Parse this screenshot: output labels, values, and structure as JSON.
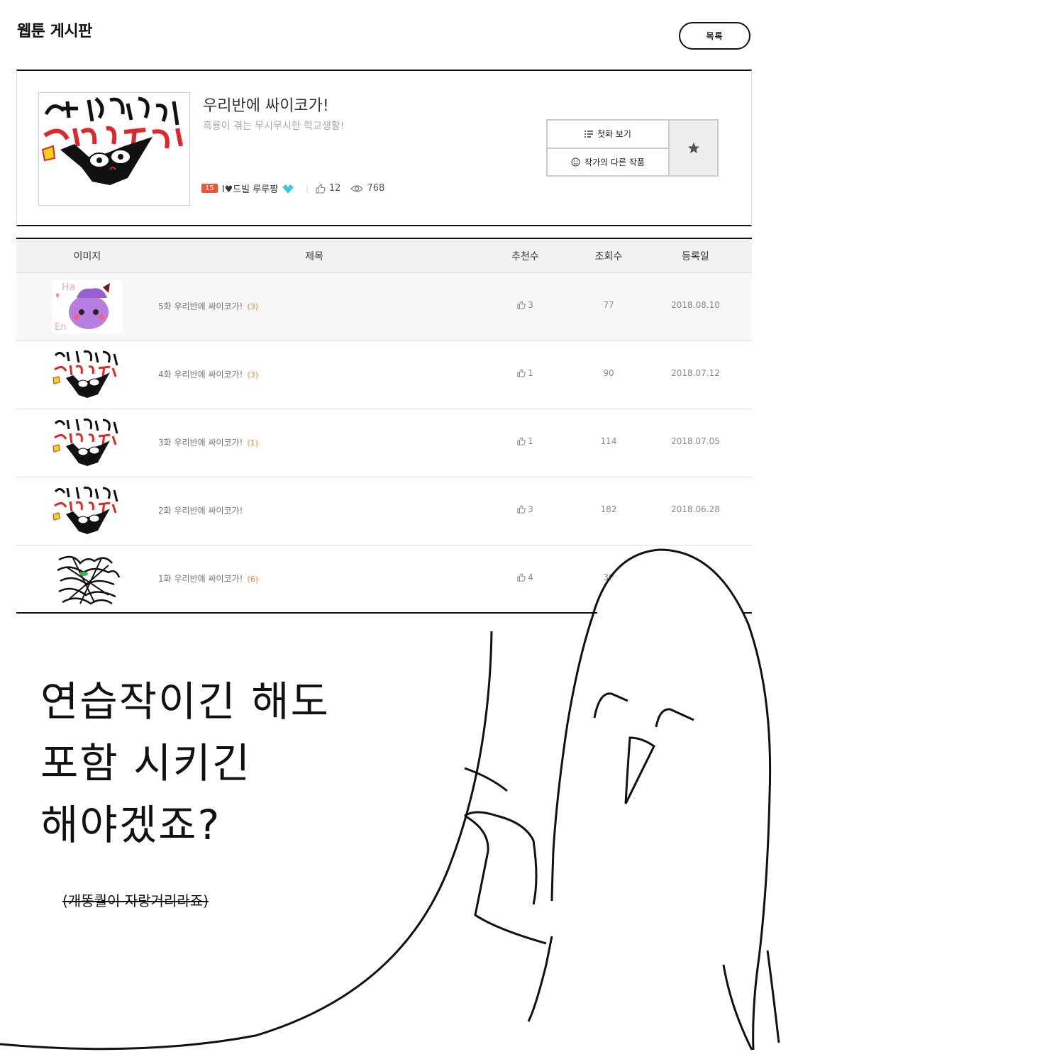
{
  "board": {
    "title": "웹툰 게시판",
    "list_button": "목록"
  },
  "work": {
    "title": "우리반에 싸이코가!",
    "description": "흑룡이 겪는 무시무시한 학교생활!",
    "age_badge": "15",
    "author": "I♥드빌 루루짱",
    "likes": "12",
    "views": "768",
    "first_episode_label": "첫화 보기",
    "other_works_label": "작가의 다른 작품"
  },
  "table": {
    "headers": {
      "image": "이미지",
      "title": "제목",
      "recommend": "추천수",
      "views": "조회수",
      "date": "등록일"
    },
    "rows": [
      {
        "title": "5화 우리반에 싸이코가!",
        "comments": "(3)",
        "recommend": "3",
        "views": "77",
        "date": "2018.08.10"
      },
      {
        "title": "4화 우리반에 싸이코가!",
        "comments": "(3)",
        "recommend": "1",
        "views": "90",
        "date": "2018.07.12"
      },
      {
        "title": "3화 우리반에 싸이코가!",
        "comments": "(1)",
        "recommend": "1",
        "views": "114",
        "date": "2018.07.05"
      },
      {
        "title": "2화 우리반에 싸이코가!",
        "comments": "",
        "recommend": "3",
        "views": "182",
        "date": "2018.06.28"
      },
      {
        "title": "1화 우리반에 싸이코가!",
        "comments": "(6)",
        "recommend": "4",
        "views": "30",
        "date": ""
      }
    ]
  },
  "overlay": {
    "speech_lines": [
      "연습작이긴 해도",
      "포함 시키긴",
      "해야겠죠?"
    ],
    "strikethrough_note": "(개똥퀄이 자랑거리라죠)"
  },
  "colors": {
    "age_badge": "#e8563b",
    "comment_count": "#e8873a",
    "header_bg": "#f2f2f2"
  }
}
